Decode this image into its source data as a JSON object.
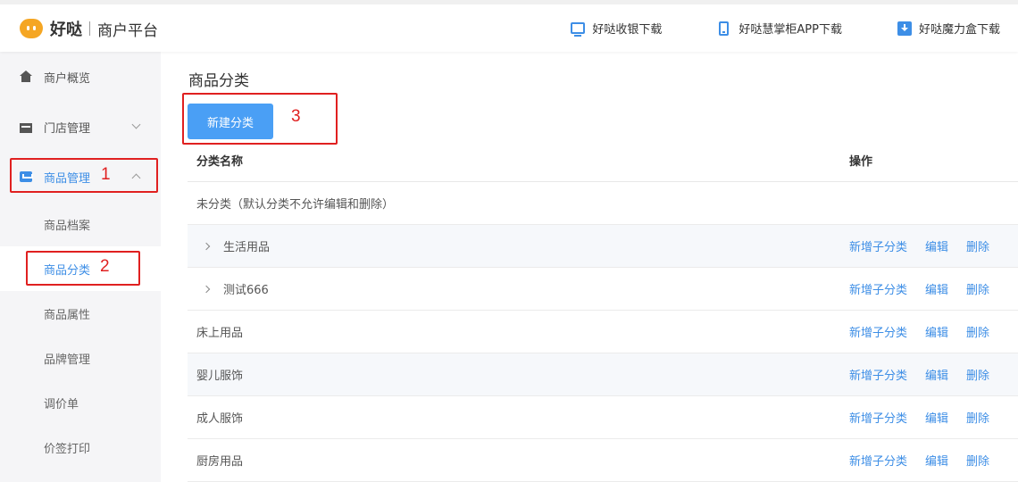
{
  "header": {
    "brand": "好哒",
    "subtitle": "商户平台",
    "links": [
      {
        "label": "好哒收银下载",
        "icon": "monitor-icon"
      },
      {
        "label": "好哒慧掌柜APP下载",
        "icon": "phone-icon"
      },
      {
        "label": "好哒魔力盒下载",
        "icon": "download-icon"
      }
    ]
  },
  "sidebar": {
    "items": [
      {
        "label": "商户概览",
        "icon": "home-icon"
      },
      {
        "label": "门店管理",
        "icon": "store-icon"
      },
      {
        "label": "商品管理",
        "icon": "goods-icon"
      }
    ],
    "subitems": [
      "商品档案",
      "商品分类",
      "商品属性",
      "品牌管理",
      "调价单",
      "价签打印"
    ]
  },
  "annotations": [
    "1",
    "2",
    "3"
  ],
  "main": {
    "title": "商品分类",
    "new_button": "新建分类",
    "table": {
      "headers": {
        "name": "分类名称",
        "op": "操作"
      },
      "rows": [
        {
          "name": "未分类（默认分类不允许编辑和删除）",
          "expandable": false,
          "actions": false
        },
        {
          "name": "生活用品",
          "expandable": true,
          "actions": true
        },
        {
          "name": "测试666",
          "expandable": true,
          "actions": true
        },
        {
          "name": "床上用品",
          "expandable": false,
          "actions": true
        },
        {
          "name": "婴儿服饰",
          "expandable": false,
          "actions": true
        },
        {
          "name": "成人服饰",
          "expandable": false,
          "actions": true
        },
        {
          "name": "厨房用品",
          "expandable": false,
          "actions": true
        }
      ],
      "action_labels": {
        "add_child": "新增子分类",
        "edit": "编辑",
        "delete": "删除"
      }
    }
  },
  "colors": {
    "accent": "#3d8ee6",
    "button": "#4a9ff5",
    "annotation": "#e02020",
    "logo": "#f5a623"
  }
}
